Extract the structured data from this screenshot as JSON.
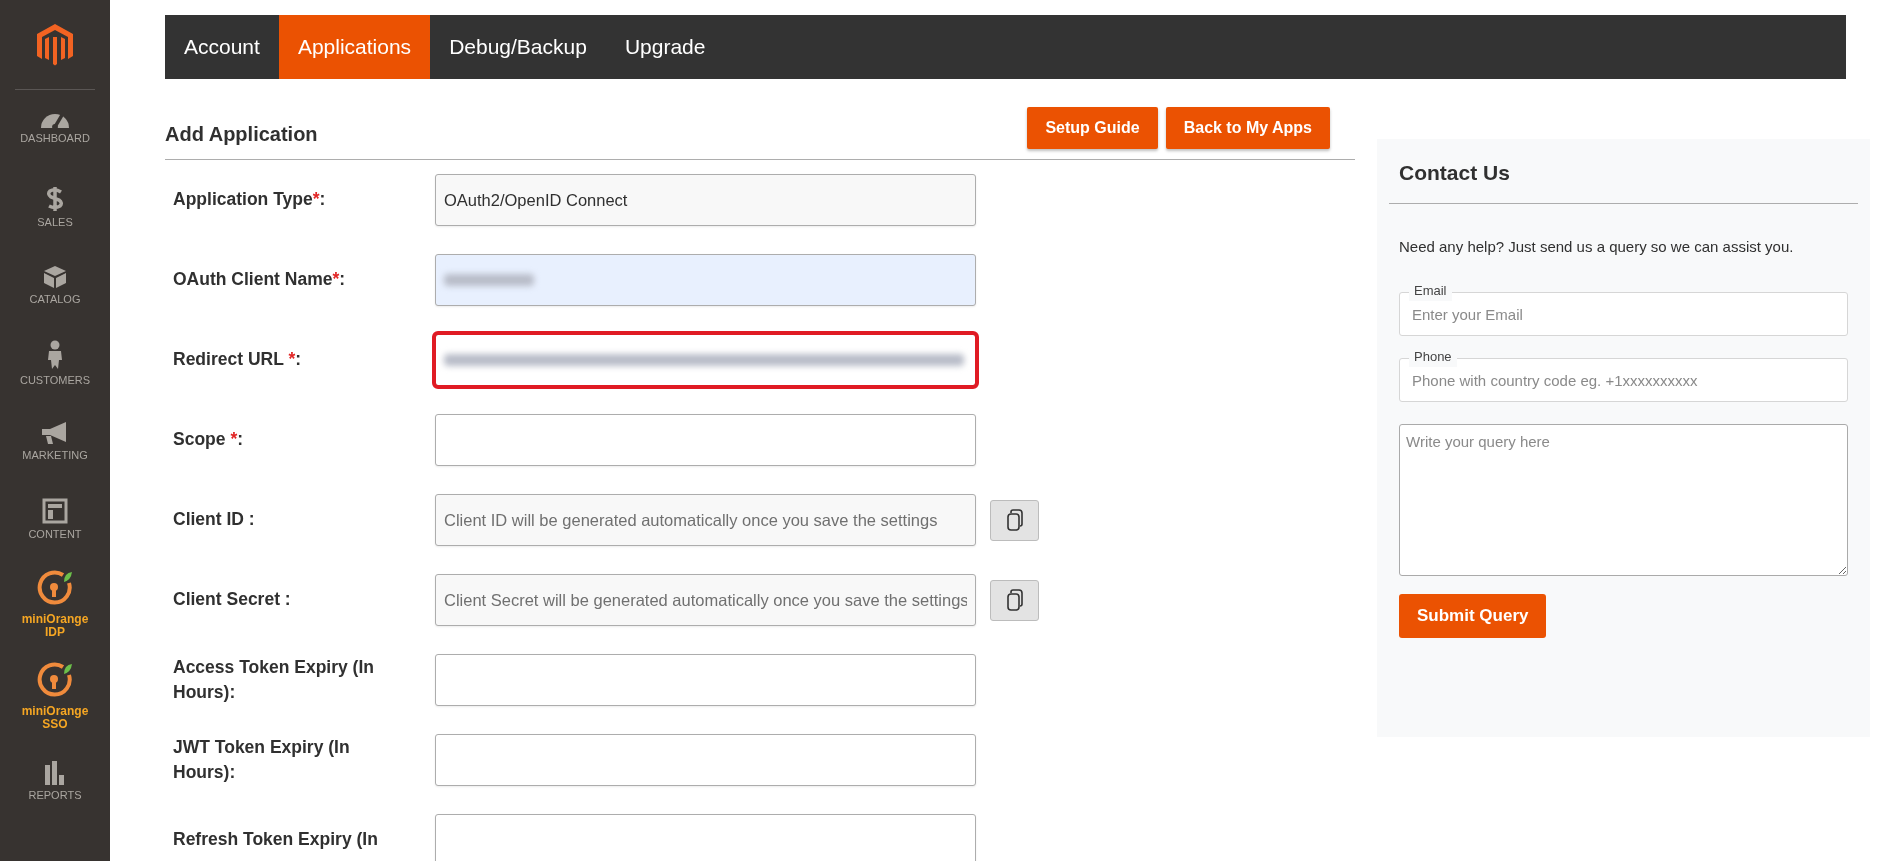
{
  "sidebar": {
    "items": [
      {
        "kind": "dashboard",
        "label": "DASHBOARD",
        "accent": false
      },
      {
        "kind": "sales",
        "label": "SALES",
        "accent": false
      },
      {
        "kind": "catalog",
        "label": "CATALOG",
        "accent": false
      },
      {
        "kind": "customers",
        "label": "CUSTOMERS",
        "accent": false
      },
      {
        "kind": "marketing",
        "label": "MARKETING",
        "accent": false
      },
      {
        "kind": "content",
        "label": "CONTENT",
        "accent": false
      },
      {
        "kind": "plugin",
        "label": "miniOrange IDP",
        "accent": true
      },
      {
        "kind": "plugin",
        "label": "miniOrange SSO",
        "accent": true
      },
      {
        "kind": "reports",
        "label": "REPORTS",
        "accent": false
      }
    ]
  },
  "tabs": [
    {
      "label": "Account",
      "selected": false
    },
    {
      "label": "Applications",
      "selected": true
    },
    {
      "label": "Debug/Backup",
      "selected": false
    },
    {
      "label": "Upgrade",
      "selected": false
    }
  ],
  "form": {
    "title": "Add Application",
    "buttons": [
      "Setup Guide",
      "Back to My Apps"
    ],
    "fields": [
      {
        "label": "Application Type",
        "required_mark": "*",
        "suffix": ":",
        "value": "OAuth2/OpenID Connect",
        "readonly": true
      },
      {
        "label": "OAuth Client Name",
        "required_mark": "*",
        "suffix": ":",
        "blurred": true,
        "autofilled": true
      },
      {
        "label": "Redirect URL ",
        "required_mark": "*",
        "suffix": ":",
        "blurred": true,
        "highlighted": true
      },
      {
        "label": "Scope ",
        "required_mark": "*",
        "suffix": ":"
      },
      {
        "label": "Client ID :",
        "placeholder": "Client ID will be generated automatically once you save the settings",
        "readonly": true,
        "copy": true
      },
      {
        "label": "Client Secret :",
        "placeholder": "Client Secret will be generated automatically once you save the settings",
        "readonly": true,
        "copy": true
      },
      {
        "label": "Access Token Expiry (In Hours):"
      },
      {
        "label": "JWT Token Expiry (In Hours):"
      },
      {
        "label": "Refresh Token Expiry (In"
      }
    ]
  },
  "contact": {
    "title": "Contact Us",
    "intro": "Need any help? Just send us a query so we can assist you.",
    "email": {
      "label": "Email",
      "placeholder": "Enter your Email"
    },
    "phone": {
      "label": "Phone",
      "placeholder": "Phone with country code eg. +1xxxxxxxxxx"
    },
    "query": {
      "placeholder": "Write your query here"
    },
    "submit": "Submit Query"
  }
}
